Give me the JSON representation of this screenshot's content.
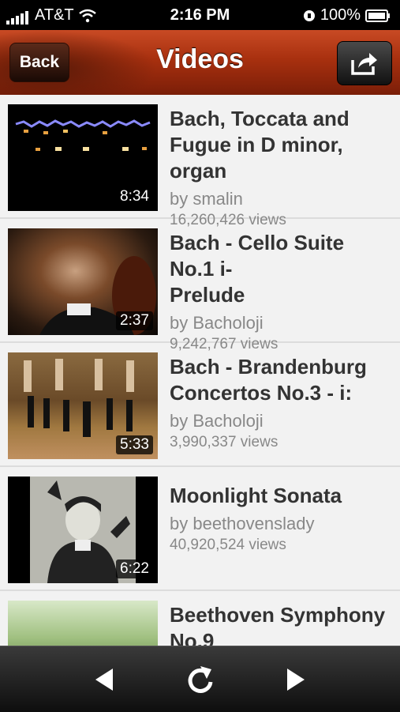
{
  "status": {
    "carrier": "AT&T",
    "time": "2:16 PM",
    "battery": "100%"
  },
  "header": {
    "title": "Videos",
    "back_label": "Back"
  },
  "videos": [
    {
      "title_line1": "Bach, Toccata and",
      "title_line2": "Fugue in D minor, organ",
      "author": "by smalin",
      "views": "16,260,426 views",
      "duration": "8:34"
    },
    {
      "title_line1": "Bach - Cello Suite No.1 i-",
      "title_line2": "Prelude",
      "author": "by Bacholoji",
      "views": "9,242,767 views",
      "duration": "2:37"
    },
    {
      "title_line1": "Bach - Brandenburg",
      "title_line2": "Concertos No.3 - i:",
      "author": "by Bacholoji",
      "views": "3,990,337 views",
      "duration": "5:33"
    },
    {
      "title_line1": "Moonlight Sonata",
      "title_line2": "",
      "author": "by beethovenslady",
      "views": "40,920,524 views",
      "duration": "6:22"
    },
    {
      "title_line1": "Beethoven Symphony",
      "title_line2": "No.9",
      "author": "",
      "views": "",
      "duration": ""
    }
  ],
  "icons": {
    "back": "triangle-left-icon",
    "refresh": "refresh-icon",
    "forward": "triangle-right-icon",
    "share": "share-icon",
    "wifi": "wifi-icon",
    "battery": "battery-icon",
    "lock": "orientation-lock-icon"
  }
}
